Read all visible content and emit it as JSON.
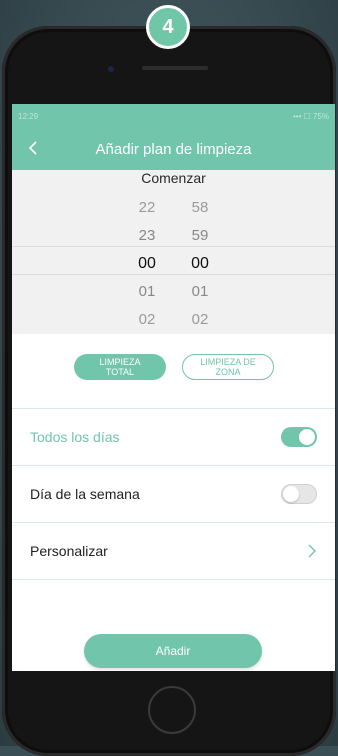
{
  "step_badge": "4",
  "status_bar": {
    "time": "12:29",
    "indicators": "••• ☐ 75%"
  },
  "nav": {
    "back_icon": "chevron-left-icon",
    "title": "Añadir plan de limpieza"
  },
  "picker": {
    "title": "Comenzar",
    "hours": [
      "22",
      "23",
      "00",
      "01",
      "02"
    ],
    "minutes": [
      "58",
      "59",
      "00",
      "01",
      "02"
    ],
    "selected_hour": "00",
    "selected_minute": "00"
  },
  "modes": {
    "total": {
      "line1": "LIMPIEZA",
      "line2": "TOTAL",
      "active": true
    },
    "zone": {
      "line1": "LIMPIEZA DE",
      "line2": "ZONA",
      "active": false
    }
  },
  "options": {
    "every_day": {
      "label": "Todos los días",
      "enabled": true
    },
    "weekday": {
      "label": "Día de la semana",
      "enabled": false
    },
    "custom": {
      "label": "Personalizar",
      "icon": "chevron-right-icon"
    }
  },
  "add_button": "Añadir",
  "colors": {
    "accent": "#70c5aa",
    "background": "#3a4e55"
  }
}
